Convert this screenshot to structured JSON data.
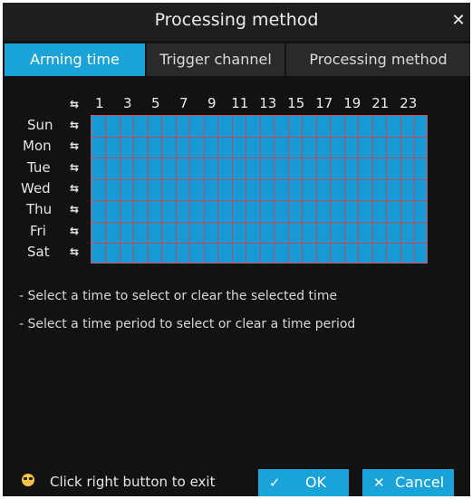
{
  "dialog": {
    "title": "Processing method",
    "close_label": "✕"
  },
  "tabs": [
    {
      "label": "Arming time",
      "active": true
    },
    {
      "label": "Trigger channel",
      "active": false
    },
    {
      "label": "Processing method",
      "active": false
    }
  ],
  "schedule": {
    "hour_labels": [
      "1",
      "3",
      "5",
      "7",
      "9",
      "11",
      "13",
      "15",
      "17",
      "19",
      "21",
      "23"
    ],
    "days": [
      "Sun",
      "Mon",
      "Tue",
      "Wed",
      "Thu",
      "Fri",
      "Sat"
    ],
    "toggle_glyph": "⇆",
    "hours_per_day": 24,
    "all_selected": true,
    "fill_color": "#1a9ad4",
    "line_color": "#b84d5c"
  },
  "hints": [
    "- Select a time to select or clear the selected time",
    "- Select a time period to select or clear a time period"
  ],
  "footer": {
    "exit_text": "Click right button to exit",
    "exit_icon": "face-icon",
    "ok_label": "OK",
    "ok_icon": "✓",
    "cancel_label": "Cancel",
    "cancel_icon": "✕"
  },
  "colors": {
    "accent": "#1aa3d9",
    "background": "#121212"
  }
}
